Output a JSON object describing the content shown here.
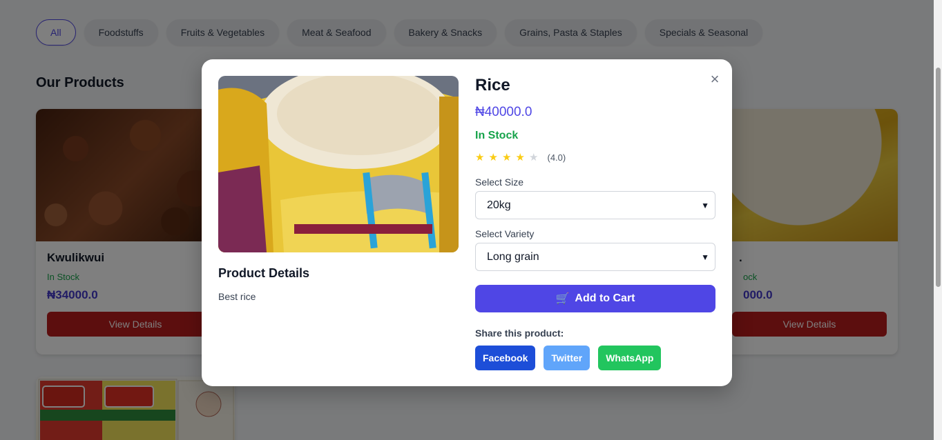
{
  "filters": [
    "All",
    "Foodstuffs",
    "Fruits & Vegetables",
    "Meat & Seafood",
    "Bakery & Snacks",
    "Grains, Pasta & Staples",
    "Specials & Seasonal"
  ],
  "section_title": "Our Products",
  "cards": [
    {
      "name": "Kwulikwui",
      "stock": "In Stock",
      "price": "₦34000.0",
      "button": "View Details"
    },
    {
      "name": ".",
      "stock": "ock",
      "price": "000.0",
      "button": "View Details"
    }
  ],
  "modal": {
    "close": "×",
    "product_name": "Rice",
    "price": "₦40000.0",
    "stock": "In Stock",
    "rating": 4,
    "rating_max": 5,
    "rating_text": "(4.0)",
    "size_label": "Select Size",
    "size_value": "20kg",
    "variety_label": "Select Variety",
    "variety_value": "Long grain",
    "cart_icon": "🛒",
    "cart_label": "Add to Cart",
    "details_title": "Product Details",
    "details_text": "Best rice",
    "share_label": "Share this product:",
    "share": {
      "facebook": "Facebook",
      "twitter": "Twitter",
      "whatsapp": "WhatsApp"
    }
  },
  "colors": {
    "accent": "#4f46e5",
    "stock": "#16a34a",
    "view_button": "#b91c1c"
  }
}
